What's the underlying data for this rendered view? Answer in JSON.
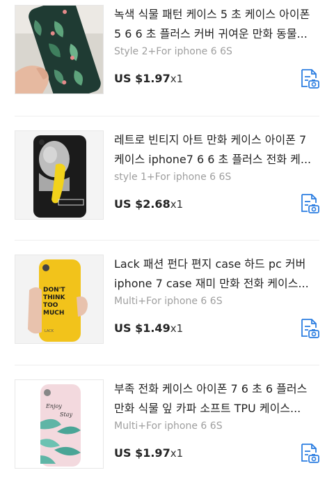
{
  "colors": {
    "icon_blue": "#2b7de1",
    "variant_gray": "#9e9e9e"
  },
  "items": [
    {
      "title_line1": "녹색 식물 패턴 케이스 5 초 케이스 아이폰",
      "title_line2": "5 6 6 초 플러스 커버 귀여운 만화 동물...",
      "variant": "Style 2+For iphone 6 6S",
      "price": "US $1.97",
      "qty": "x1",
      "action_icon": "image-search-icon"
    },
    {
      "title_line1": "레트로 빈티지 아트 만화 케이스 아이폰 7",
      "title_line2": "케이스 iphone7 6 6 초 플러스 전화 케...",
      "variant": "style 1+For iphone 6 6S",
      "price": "US $2.68",
      "qty": "x1",
      "action_icon": "image-search-icon"
    },
    {
      "title_line1": "Lack 패션 펀다 편지 case 하드 pc 커버",
      "title_line2": "iphone 7 case 재미 만화 전화 케이스...",
      "variant": "Multi+For iphone 6 6S",
      "price": "US $1.49",
      "qty": "x1",
      "action_icon": "image-search-icon",
      "case_text": "DON'T THINK TOO MUCH",
      "case_brand": "LACK"
    },
    {
      "title_line1": "부족 전화 케이스 아이폰 7 6 초 6 플러스",
      "title_line2": "만화 식물 잎 카파 소프트 TPU 케이스...",
      "variant": "Multi+For iphone 6 6S",
      "price": "US $1.97",
      "qty": "x1",
      "action_icon": "image-search-icon"
    }
  ]
}
